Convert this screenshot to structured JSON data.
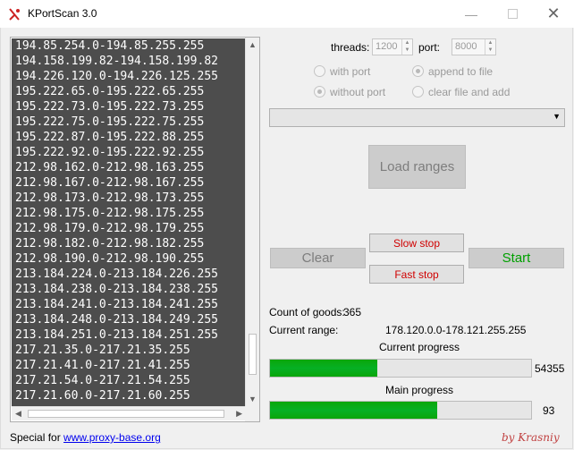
{
  "window": {
    "title": "KPortScan 3.0"
  },
  "ranges": [
    "194.85.254.0-194.85.255.255",
    "194.158.199.82-194.158.199.82",
    "194.226.120.0-194.226.125.255",
    "195.222.65.0-195.222.65.255",
    "195.222.73.0-195.222.73.255",
    "195.222.75.0-195.222.75.255",
    "195.222.87.0-195.222.88.255",
    "195.222.92.0-195.222.92.255",
    "212.98.162.0-212.98.163.255",
    "212.98.167.0-212.98.167.255",
    "212.98.173.0-212.98.173.255",
    "212.98.175.0-212.98.175.255",
    "212.98.179.0-212.98.179.255",
    "212.98.182.0-212.98.182.255",
    "212.98.190.0-212.98.190.255",
    "213.184.224.0-213.184.226.255",
    "213.184.238.0-213.184.238.255",
    "213.184.241.0-213.184.241.255",
    "213.184.248.0-213.184.249.255",
    "213.184.251.0-213.184.251.255",
    "217.21.35.0-217.21.35.255",
    "217.21.41.0-217.21.41.255",
    "217.21.54.0-217.21.54.255",
    "217.21.60.0-217.21.60.255"
  ],
  "settings": {
    "threads_label": "threads:",
    "threads_value": "1200",
    "port_label": "port:",
    "port_value": "8000"
  },
  "radios": {
    "with_port": "with port",
    "without_port": "without port",
    "append_to_file": "append to file",
    "clear_file_and_add": "clear file and add"
  },
  "buttons": {
    "load_ranges": "Load ranges",
    "slow_stop": "Slow stop",
    "clear": "Clear",
    "start": "Start",
    "fast_stop": "Fast stop"
  },
  "status": {
    "count_label": "Count of goods:",
    "count_value": "365",
    "range_label": "Current range:",
    "range_value": "178.120.0.0-178.121.255.255",
    "current_progress_label": "Current progress",
    "current_progress_value": "54355",
    "current_progress_fraction": 0.41,
    "main_progress_label": "Main progress",
    "main_progress_value": "93",
    "main_progress_fraction": 0.64
  },
  "footer": {
    "special_for": "Special for",
    "link": "www.proxy-base.org",
    "author": "by Krasniy"
  },
  "colors": {
    "list_bg": "#4d4d4d",
    "progress_green": "#06b025",
    "stop_red": "#d00000",
    "start_green": "#00a000",
    "author_red": "#c04040"
  }
}
